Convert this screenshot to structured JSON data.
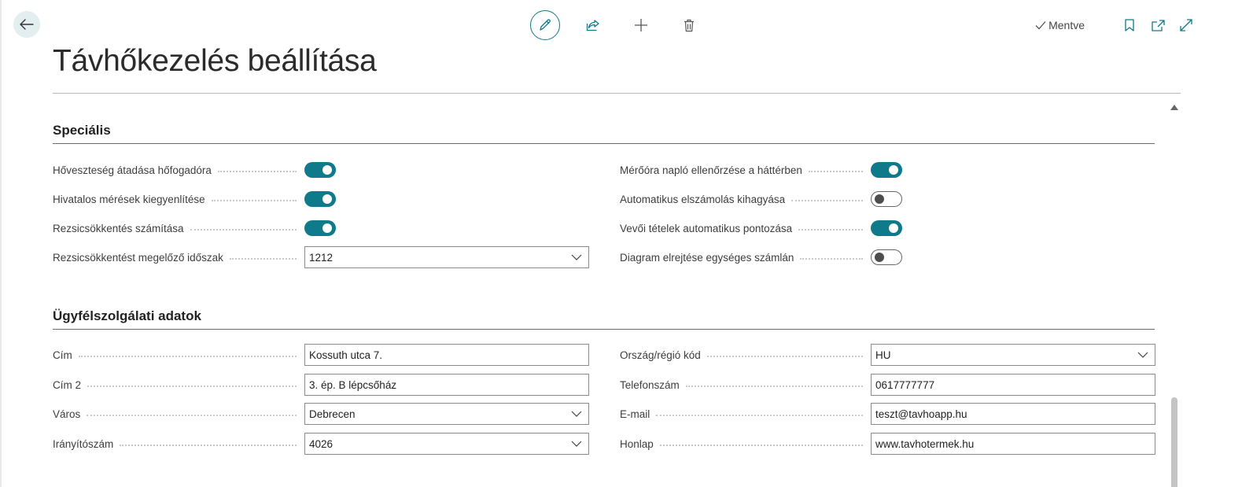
{
  "header": {
    "title": "Távhőkezelés beállítása",
    "saved_status": "Mentve"
  },
  "icons": {
    "back": "arrow-left-icon",
    "edit": "pencil-icon",
    "share": "share-icon",
    "new": "plus-icon",
    "delete": "trash-icon",
    "saved": "checkmark-icon",
    "bookmark": "bookmark-icon",
    "open_new_window": "open-in-new-window-icon",
    "expand": "expand-icon",
    "collapse": "caret-up-icon",
    "dropdown": "chevron-down-icon"
  },
  "colors": {
    "accent": "#0f7b8a",
    "toggle_off_knob": "#4d4d4d"
  },
  "special": {
    "heading": "Speciális",
    "left": [
      {
        "label": "Hőveszteség átadása hőfogadóra",
        "type": "toggle",
        "value": true
      },
      {
        "label": "Hivatalos mérések kiegyenlítése",
        "type": "toggle",
        "value": true
      },
      {
        "label": "Rezsicsökkentés számítása",
        "type": "toggle",
        "value": true
      },
      {
        "label": "Rezsicsökkentést megelőző időszak",
        "type": "select",
        "value": "1212"
      }
    ],
    "right": [
      {
        "label": "Mérőóra napló ellenőrzése a háttérben",
        "type": "toggle",
        "value": true
      },
      {
        "label": "Automatikus elszámolás kihagyása",
        "type": "toggle",
        "value": false
      },
      {
        "label": "Vevői tételek automatikus pontozása",
        "type": "toggle",
        "value": true
      },
      {
        "label": "Diagram elrejtése egységes számlán",
        "type": "toggle",
        "value": false
      }
    ]
  },
  "customer_service": {
    "heading": "Ügyfélszolgálati adatok",
    "left": [
      {
        "label": "Cím",
        "type": "text",
        "value": "Kossuth utca 7."
      },
      {
        "label": "Cím 2",
        "type": "text",
        "value": "3. ép. B lépcsőház"
      },
      {
        "label": "Város",
        "type": "select",
        "value": "Debrecen"
      },
      {
        "label": "Irányítószám",
        "type": "select",
        "value": "4026"
      }
    ],
    "right": [
      {
        "label": "Ország/régió kód",
        "type": "select",
        "value": "HU"
      },
      {
        "label": "Telefonszám",
        "type": "text",
        "value": "0617777777"
      },
      {
        "label": "E-mail",
        "type": "text",
        "value": "teszt@tavhoapp.hu"
      },
      {
        "label": "Honlap",
        "type": "text",
        "value": "www.tavhotermek.hu"
      }
    ]
  }
}
